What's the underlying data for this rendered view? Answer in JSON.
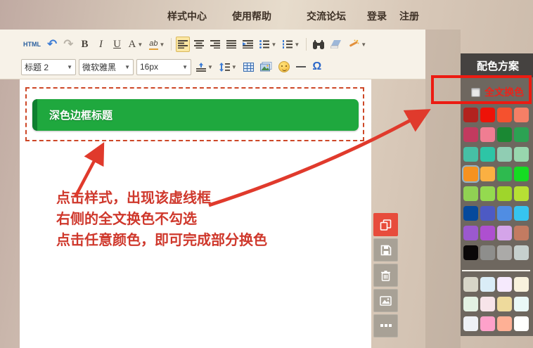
{
  "nav": {
    "items": [
      {
        "label": "样式中心"
      },
      {
        "label": "使用帮助"
      },
      {
        "label": "交流论坛"
      },
      {
        "label": "登录"
      },
      {
        "label": "注册"
      }
    ]
  },
  "toolbar": {
    "row1": {
      "html_label": "HTML",
      "undo_glyph": "↶",
      "redo_glyph": "↷",
      "bold_label": "B",
      "italic_label": "I",
      "underline_label": "U",
      "font_color_label": "A",
      "highlight_label": "ab",
      "active_button": "align-left"
    },
    "row2": {
      "heading_value": "标题 2",
      "font_family_value": "微软雅黑",
      "font_size_value": "16px",
      "omega_label": "Ω"
    }
  },
  "editor": {
    "banner_text": "深色边框标题"
  },
  "annotation": {
    "lines": [
      "点击样式，出现该虚线框",
      "右侧的全文换色不勾选",
      "点击任意颜色，即可完成部分换色"
    ],
    "color": "#cf382c"
  },
  "side_toolbar": {
    "buttons": [
      "copy-style",
      "save",
      "delete",
      "image",
      "more"
    ],
    "active": "copy-style",
    "active_color": "#e74c3c"
  },
  "panel": {
    "title": "配色方案",
    "checkbox_label": "全文换色",
    "checkbox_checked": false,
    "header_bg": "#454240",
    "body_bg": "#6e675f",
    "highlight_border": "#ec1b12"
  },
  "swatches": {
    "bright": [
      [
        "#b2221e",
        "#ee1208",
        "#f5512e",
        "#f57f66"
      ],
      [
        "#c23a5f",
        "#f07d92",
        "#1a8833",
        "#2ca253"
      ],
      [
        "#46c0a5",
        "#2dc5a6",
        "#90cdb3",
        "#98d7ae"
      ],
      [
        "#f69220",
        "#fbb042",
        "#2eba4f",
        "#15dc22"
      ],
      [
        "#90d153",
        "#94da4f",
        "#9fd52b",
        "#b7e034"
      ],
      [
        "#064a9c",
        "#4d5ac4",
        "#508de3",
        "#36c4ef"
      ],
      [
        "#9b59cf",
        "#ae4fd0",
        "#d4a4e9",
        "#c37b61"
      ],
      [
        "#0a0708",
        "#8e8e8c",
        "#abaaa8",
        "#c6d0ce"
      ]
    ],
    "pastel": [
      [
        "#d7d5c7",
        "#daedf7",
        "#f6eafd",
        "#f8f2dd"
      ],
      [
        "#e3f2e3",
        "#f7e4e9",
        "#eeda9c",
        "#eaf9f7"
      ],
      [
        "#eef1f5",
        "#fea1ca",
        "#feb095",
        "#fffffe"
      ]
    ],
    "selected": {
      "grid": "bright",
      "row": 3,
      "col": 0
    }
  },
  "colors": {
    "banner_green": "#1fa83e",
    "banner_dark_green": "#0e7f2f",
    "dashed_border": "#cd4727",
    "arrow_red": "#e03a2c",
    "toolbar_bg": "#f7f2e8"
  }
}
